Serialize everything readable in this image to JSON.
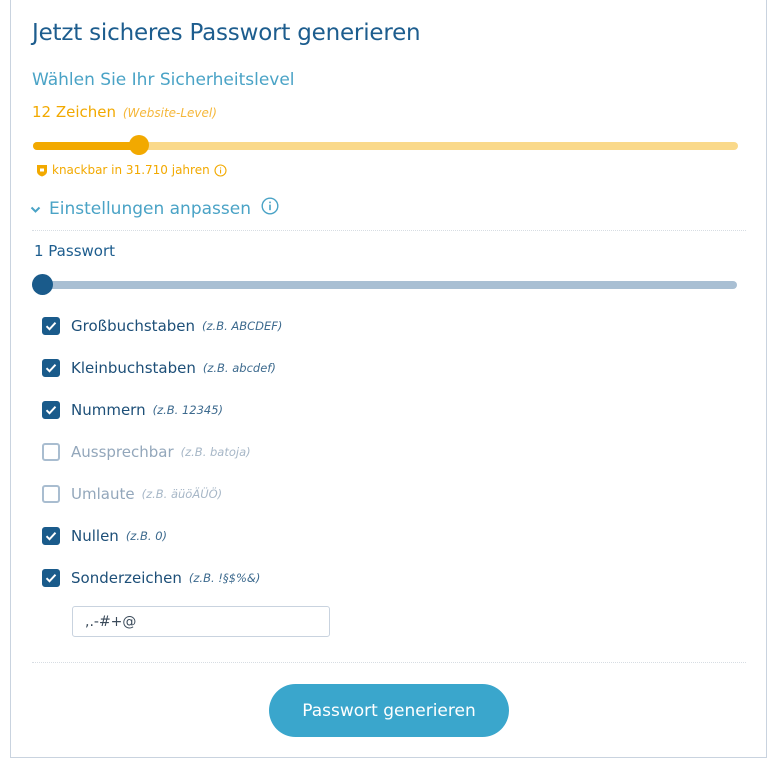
{
  "header": {
    "title": "Jetzt sicheres Passwort generieren",
    "subtitle": "Wählen Sie Ihr Sicherheitslevel"
  },
  "level": {
    "label": "12 Zeichen",
    "hint": "(Website-Level)",
    "slider_value_fraction": 0.15,
    "crack_text": "knackbar in 31.710 jahren",
    "colors": {
      "accent": "#f2a900",
      "track": "#fad98a"
    }
  },
  "settings": {
    "toggle_label": "Einstellungen anpassen",
    "toggle_icon": "chevron-down-icon",
    "info_icon": "info-icon"
  },
  "count": {
    "label": "1 Passwort",
    "slider_value_fraction": 0.0,
    "colors": {
      "thumb": "#1a5b8b",
      "track": "#a9bfd3"
    }
  },
  "options": [
    {
      "label": "Großbuchstaben",
      "hint": "(z.B. ABCDEF)",
      "checked": true
    },
    {
      "label": "Kleinbuchstaben",
      "hint": "(z.B. abcdef)",
      "checked": true
    },
    {
      "label": "Nummern",
      "hint": "(z.B. 12345)",
      "checked": true
    },
    {
      "label": "Aussprechbar",
      "hint": "(z.B. batoja)",
      "checked": false
    },
    {
      "label": "Umlaute",
      "hint": "(z.B. äüöÄÜÖ)",
      "checked": false
    },
    {
      "label": "Nullen",
      "hint": "(z.B. 0)",
      "checked": true
    },
    {
      "label": "Sonderzeichen",
      "hint": "(z.B. !§$%&)",
      "checked": true
    }
  ],
  "special_chars": {
    "value": ",.-#+@"
  },
  "generate_button": {
    "label": "Passwort generieren",
    "color": "#3aa6cc"
  }
}
